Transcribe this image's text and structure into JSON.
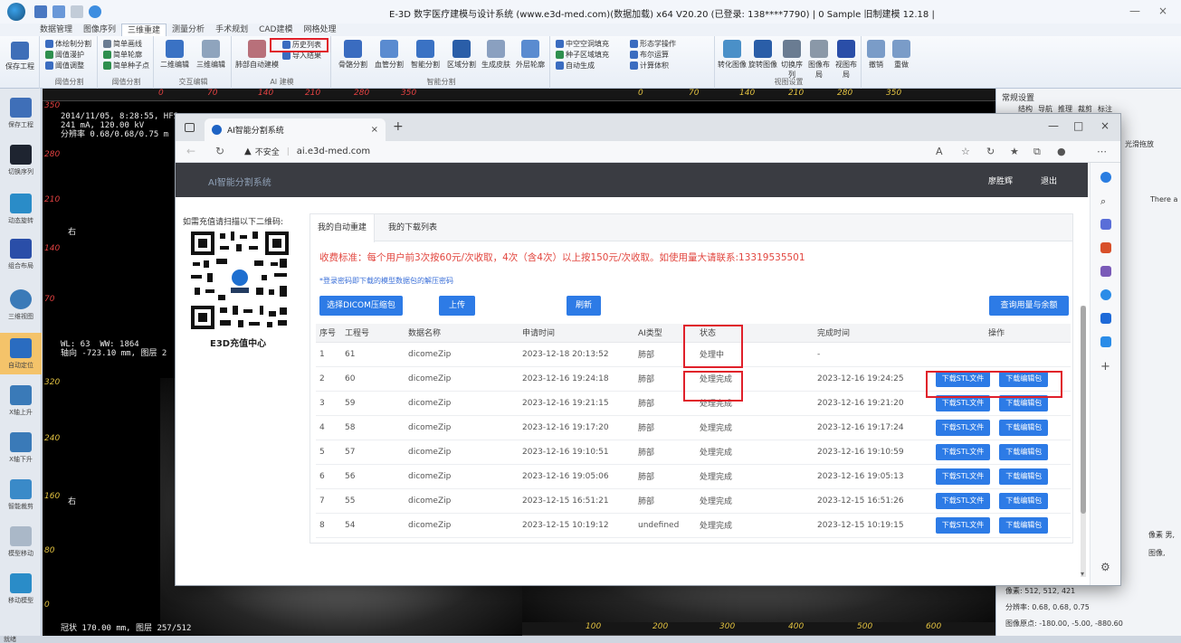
{
  "window": {
    "title": "E-3D 数字医疗建模与设计系统 (www.e3d-med.com)(数据加载) x64 V20.20 (已登录: 138****7790) | 0 Sample 旧制建模 12.18 |",
    "min_label": "—",
    "close_label": "×"
  },
  "menu": {
    "tabs": [
      "数据管理",
      "图像序列",
      "三维重建",
      "测量分析",
      "手术规划",
      "CAD建模",
      "网格处理"
    ],
    "active_index": 2
  },
  "ribbon": {
    "groups": [
      {
        "label": "阈值分割"
      },
      {
        "label": "阈值分割"
      },
      {
        "label": "交互编辑"
      },
      {
        "label": "AI 建模"
      },
      {
        "label": "智能分割"
      },
      {
        "label": "视图设置"
      }
    ],
    "buttons": {
      "save": "保存工程",
      "threshold1": "体绘制分割",
      "threshold2": "阈值漫护",
      "threshold3": "阈值调整",
      "sculpt1": "简单画线",
      "sculpt2": "简单轮廓",
      "sculpt3": "简单种子点",
      "edit2d": "二维编辑",
      "edit3d": "三维编辑",
      "lung": "肺部自动建模",
      "history": "历史列表",
      "import_result": "导入结果",
      "skel": "骨骼分割",
      "vessel": "血管分割",
      "smart": "智能分割",
      "region": "区域分割",
      "skin": "生成皮肤",
      "ext": "外层轮廓",
      "hollow": "中空空洞填充",
      "seed": "种子区域填充",
      "auto": "自动生成",
      "mode": "形态学操作",
      "calc": "布尔运算",
      "volume": "计算体积",
      "transform": "转化图像",
      "rotate": "旋转图像",
      "seq": "切换序列",
      "layout": "图像布局",
      "layout2": "视图布局",
      "undo": "撤销",
      "redo": "重做"
    }
  },
  "left_tools": {
    "items": [
      "保存工程",
      "切换序列",
      "动态旋转",
      "组合布局",
      "三维视图",
      "自动定位",
      "X轴上升",
      "X轴下升",
      "智能裁剪",
      "模型移动",
      "移动模型"
    ],
    "active_index": 5
  },
  "viewports": {
    "top_left": {
      "info_lines": [
        "2014/11/05, 8:28:55, HFS",
        "241 mA, 120.00 kV",
        "分辨率 0.68/0.68/0.75 m"
      ],
      "wl": "WL: 63  WW: 1864",
      "pos": "轴向 -723.10 mm, 图层 2",
      "side": "右",
      "bottom_info": "冠状 170.00 mm, 图层 257/512",
      "ruler": [
        "0",
        "70",
        "140",
        "210",
        "280",
        "350"
      ],
      "vruler": [
        "350",
        "280",
        "210",
        "140",
        "70",
        "0"
      ]
    },
    "top_right": {
      "ruler": [
        "0",
        "70",
        "140",
        "210",
        "280",
        "350"
      ],
      "bottom_ruler": [
        "100",
        "200",
        "300",
        "400",
        "500",
        "600"
      ]
    },
    "bottom_left": {
      "vruler": [
        "320",
        "240",
        "160",
        "80",
        "0"
      ],
      "side": "右"
    }
  },
  "right_panel": {
    "header": "常规设置",
    "tabs": [
      "结构",
      "导航",
      "推理",
      "裁剪",
      "标注"
    ],
    "checkbox": "光滑拖放",
    "partial": "There a",
    "info1": "像素: 512, 512, 421",
    "info2": "分辨率: 0.68, 0.68, 0.75",
    "info3": "图像原点: -180.00, -5.00, -880.60",
    "extra1": "像素 男,",
    "extra2": "图像,"
  },
  "status_bar": {
    "text": "就绪"
  },
  "browser": {
    "tab_title": "AI智能分割系统",
    "tab_close": "×",
    "new_tab": "+",
    "insecure_label": "不安全",
    "url": "ai.e3d-med.com",
    "min": "—",
    "max": "□",
    "close": "×"
  },
  "site": {
    "brand": "AI智能分割系统",
    "user": "廖胜辉",
    "logout": "退出",
    "qr_caption": "如需充值请扫描以下二维码:",
    "qr_label": "E3D充值中心",
    "tabs": [
      "我的自动重建",
      "我的下载列表"
    ],
    "active_tab": 0,
    "fee_note": "收费标准：每个用户前3次按60元/次收取，4次（含4次）以上按150元/次收取。如使用量大请联系:13319535501",
    "pwd_note": "*登录密码即下载的模型数据包的解压密码",
    "buttons": {
      "select": "选择DICOM压缩包",
      "upload": "上传",
      "refresh": "刷新",
      "query": "查询用量与余额"
    }
  },
  "table": {
    "headers": [
      "序号",
      "工程号",
      "数据名称",
      "申请时间",
      "AI类型",
      "状态",
      "完成时间",
      "操作"
    ],
    "download_stl": "下载STL文件",
    "download_pkg": "下载编辑包",
    "rows": [
      {
        "no": "1",
        "proj": "61",
        "name": "dicomeZip",
        "req": "2023-12-18 20:13:52",
        "type": "肺部",
        "status": "处理中",
        "done": "-",
        "actions": false
      },
      {
        "no": "2",
        "proj": "60",
        "name": "dicomeZip",
        "req": "2023-12-16 19:24:18",
        "type": "肺部",
        "status": "处理完成",
        "done": "2023-12-16 19:24:25",
        "actions": true
      },
      {
        "no": "3",
        "proj": "59",
        "name": "dicomeZip",
        "req": "2023-12-16 19:21:15",
        "type": "肺部",
        "status": "处理完成",
        "done": "2023-12-16 19:21:20",
        "actions": true
      },
      {
        "no": "4",
        "proj": "58",
        "name": "dicomeZip",
        "req": "2023-12-16 19:17:20",
        "type": "肺部",
        "status": "处理完成",
        "done": "2023-12-16 19:17:24",
        "actions": true
      },
      {
        "no": "5",
        "proj": "57",
        "name": "dicomeZip",
        "req": "2023-12-16 19:10:51",
        "type": "肺部",
        "status": "处理完成",
        "done": "2023-12-16 19:10:59",
        "actions": true
      },
      {
        "no": "6",
        "proj": "56",
        "name": "dicomeZip",
        "req": "2023-12-16 19:05:06",
        "type": "肺部",
        "status": "处理完成",
        "done": "2023-12-16 19:05:13",
        "actions": true
      },
      {
        "no": "7",
        "proj": "55",
        "name": "dicomeZip",
        "req": "2023-12-15 16:51:21",
        "type": "肺部",
        "status": "处理完成",
        "done": "2023-12-15 16:51:26",
        "actions": true
      },
      {
        "no": "8",
        "proj": "54",
        "name": "dicomeZip",
        "req": "2023-12-15 10:19:12",
        "type": "undefined",
        "status": "处理完成",
        "done": "2023-12-15 10:19:15",
        "actions": true
      }
    ]
  },
  "colors": {
    "accent": "#2d7be6",
    "fee_red": "#e2463f",
    "header_dark": "#3a3c42",
    "annotation_red": "#e0202a",
    "ruler_yellow": "#e0c040"
  }
}
